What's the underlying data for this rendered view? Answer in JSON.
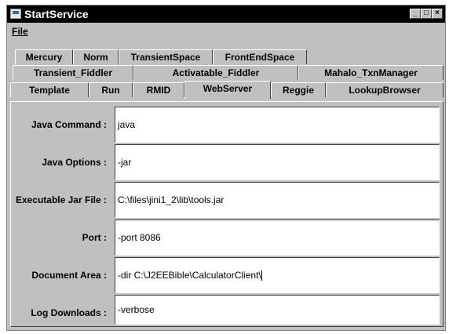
{
  "window": {
    "title": "StartService"
  },
  "menu": {
    "file": "File"
  },
  "tabs": {
    "row1": [
      "Mercury",
      "Norm",
      "TransientSpace",
      "FrontEndSpace"
    ],
    "row2": [
      "Transient_Fiddler",
      "Activatable_Fiddler",
      "Mahalo_TxnManager"
    ],
    "row3": [
      "Template",
      "Run",
      "RMID",
      "WebServer",
      "Reggie",
      "LookupBrowser"
    ],
    "selected": "WebServer"
  },
  "form": {
    "java_command": {
      "label": "Java Command :",
      "value": "java"
    },
    "java_options": {
      "label": "Java Options :",
      "value": "-jar"
    },
    "executable_jar": {
      "label": "Executable Jar File :",
      "value": "C:\\files\\jini1_2\\lib\\tools.jar"
    },
    "port": {
      "label": "Port :",
      "value": "-port 8086"
    },
    "document_area": {
      "label": "Document Area :",
      "value": "-dir C:\\J2EEBible\\CalculatorClient\\"
    },
    "log_downloads": {
      "label": "Log Downloads :",
      "value": "-verbose"
    }
  }
}
